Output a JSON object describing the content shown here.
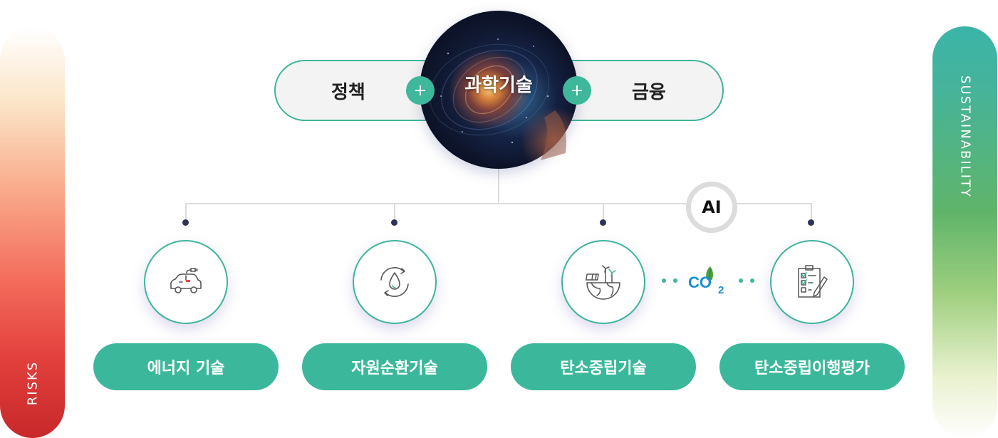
{
  "side_labels": {
    "left": "RISKS",
    "right": "SUSTAINABILITY"
  },
  "top": {
    "left_pill": "정책",
    "center": "과학기술",
    "right_pill": "금융",
    "plus_symbol": "+"
  },
  "ai_badge": "AI",
  "categories": [
    {
      "label": "에너지 기술",
      "icon": "electric-car-icon"
    },
    {
      "label": "자원순환기술",
      "icon": "water-cycle-icon"
    },
    {
      "label": "탄소중립기술",
      "icon": "earth-renewables-icon"
    },
    {
      "label": "탄소중립이행평가",
      "icon": "checklist-pen-icon"
    }
  ],
  "co2": {
    "main": "CO",
    "sub": "2"
  },
  "colors": {
    "accent_green": "#3bb89b",
    "risks_gradient_end": "#c8282a",
    "sustainability_gradient_start": "#3ab4a9",
    "dot_navy": "#2d3350",
    "co2_blue": "#1a8fd0"
  }
}
